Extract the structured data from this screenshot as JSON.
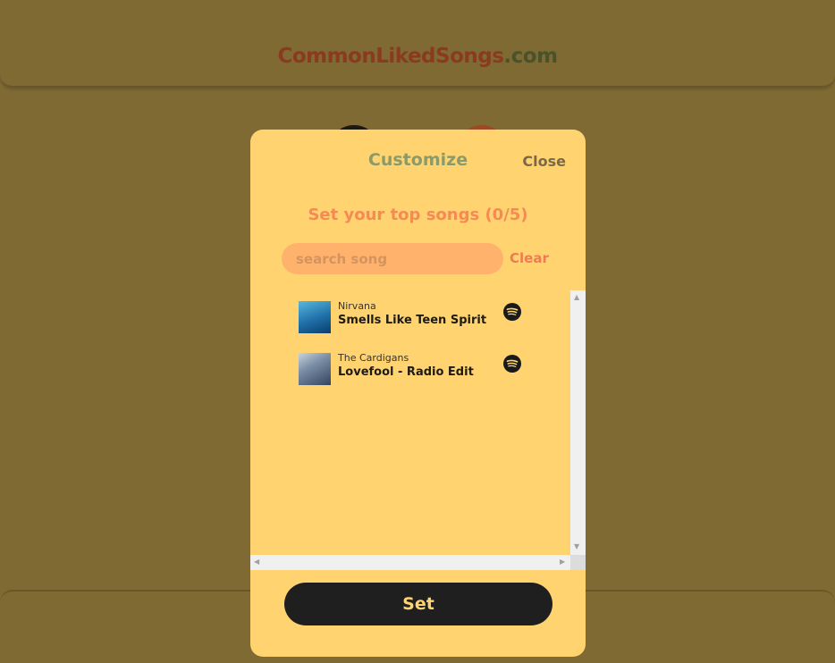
{
  "header": {
    "logo_main": "CommonLikedSongs",
    "logo_tld": ".com"
  },
  "modal": {
    "title": "Customize",
    "close_label": "Close",
    "subtitle": "Set your top songs (0/5)",
    "search": {
      "placeholder": "search song",
      "value": ""
    },
    "clear_label": "Clear",
    "results": [
      {
        "artist": "Nirvana",
        "track": "Smells Like Teen Spirit",
        "icon": "spotify-icon"
      },
      {
        "artist": "The Cardigans",
        "track": "Lovefool - Radio Edit",
        "icon": "spotify-icon"
      }
    ],
    "set_label": "Set"
  },
  "colors": {
    "page_background": "#7f6a34",
    "modal_background": "#ffd470",
    "accent": "#f58a55",
    "button_dark": "#1f1f1f"
  }
}
